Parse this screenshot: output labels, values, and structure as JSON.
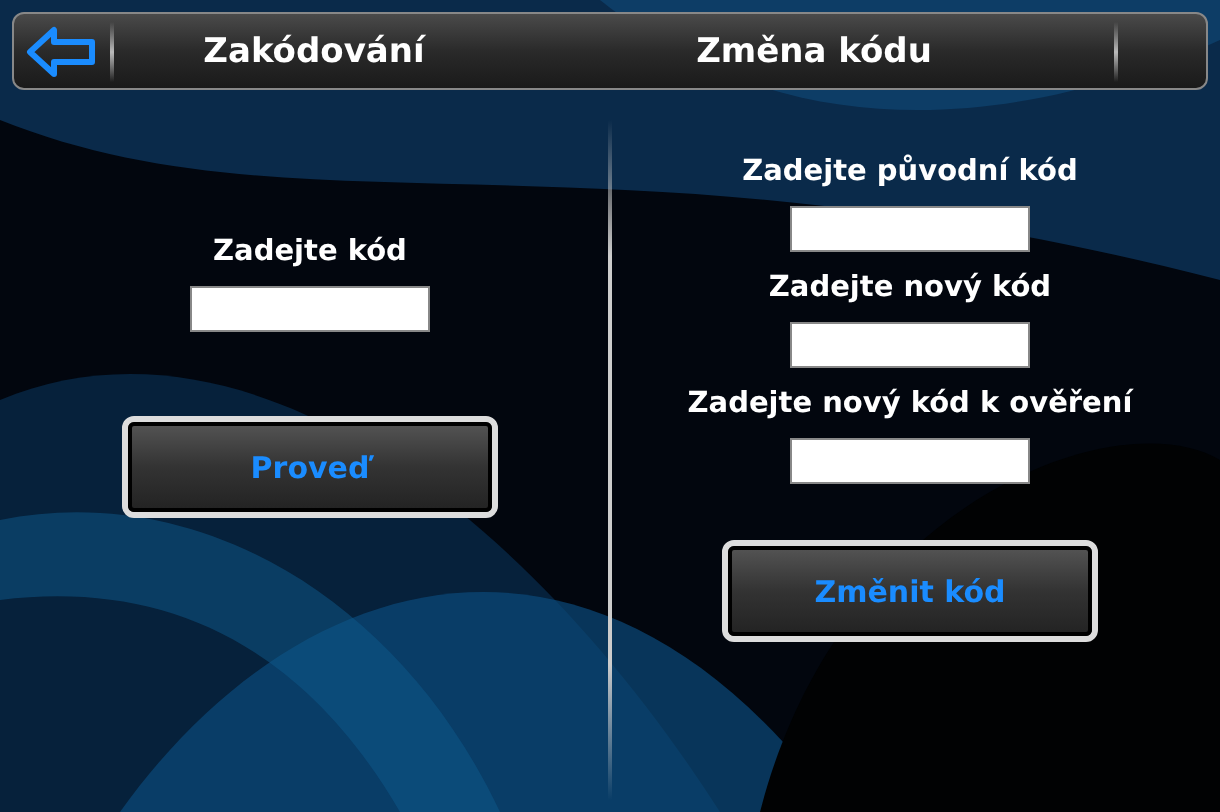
{
  "header": {
    "titles": [
      "Zakódování",
      "Změna kódu"
    ]
  },
  "encode_panel": {
    "fields": [
      {
        "label": "Zadejte kód"
      }
    ],
    "button": "Proveď"
  },
  "change_panel": {
    "fields": [
      {
        "label": "Zadejte původní kód"
      },
      {
        "label": "Zadejte nový kód"
      },
      {
        "label": "Zadejte nový kód k ověření"
      }
    ],
    "button": "Změnit kód"
  }
}
